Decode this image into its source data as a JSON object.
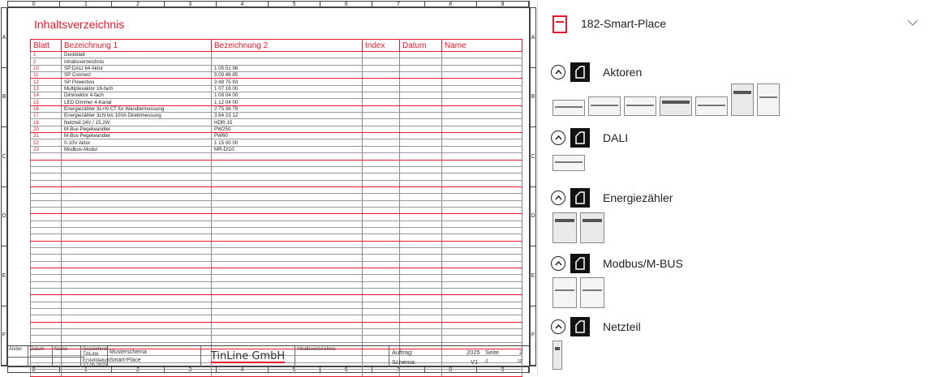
{
  "sheet": {
    "ruler_columns": [
      "0",
      "1",
      "2",
      "3",
      "4",
      "5",
      "6",
      "7",
      "8",
      "9"
    ],
    "ruler_rows": [
      "A",
      "B",
      "C",
      "D",
      "E",
      "F"
    ],
    "title": "Inhaltsverzeichnis",
    "columns": [
      "Blatt",
      "Bezeichnung 1",
      "Bezeichnung 2",
      "Index",
      "Datum",
      "Name"
    ],
    "rows": [
      [
        "1",
        "Deckblatt",
        ""
      ],
      [
        "2",
        "Inhaltsverzeichnis",
        ""
      ],
      [
        "10",
        "SP DALI 64 Aktor",
        "1 05 51 96"
      ],
      [
        "11",
        "SP Connect",
        "5 09 46 85"
      ],
      [
        "12",
        "SP Powerbox",
        "3 88 75 93"
      ],
      [
        "13",
        "Multiplexaktor 16-fach",
        "1 07 16 00"
      ],
      [
        "14",
        "Dimmaktor 4-fach",
        "1 08 04 00"
      ],
      [
        "15",
        "LED Dimmer 4-Kanal",
        "1 12 04 00"
      ],
      [
        "16",
        "Energiezähler 3L+N CT für Wandlermessung",
        "2 75 36 79"
      ],
      [
        "17",
        "Energiezähler 3LN bis 100A Direktmessung",
        "3 84 23 12"
      ],
      [
        "18",
        "Netzteil 24V / 15.2W",
        "HDR-15"
      ],
      [
        "20",
        "M-Bus Pegelwandler",
        "PW250"
      ],
      [
        "21",
        "M-Bus Pegelwandler",
        "PW60"
      ],
      [
        "22",
        "0-10V Aktor",
        "1 15 00 00"
      ],
      [
        "23",
        "Modbus-Modul",
        "MR-DI10"
      ]
    ],
    "title_block": {
      "aenderung": "Änder.",
      "datum": "Datum",
      "name": "Name",
      "gezeichnet": "Gezeichnet TinLine",
      "erstelldatum": "Erstelldatum 27.05.2025",
      "schema_name": "Musterschema",
      "project": "Smart-Place",
      "company": "TinLine  GmbH",
      "sheet_name": "Inhaltsverzeichnis",
      "auftrag_label": "Auftrag:",
      "auftrag_value": "2025",
      "schema_label": "Schema:",
      "schema_value": "V1",
      "seite_label": "Seite",
      "seite_value": "2",
      "von": "/1",
      "total": "10"
    }
  },
  "panel": {
    "project_name": "182-Smart-Place",
    "groups": [
      {
        "label": "Aktoren"
      },
      {
        "label": "DALI"
      },
      {
        "label": "Energiezähler"
      },
      {
        "label": "Modbus/M-BUS"
      },
      {
        "label": "Netzteil"
      }
    ],
    "colors": {
      "accent": "#e8192c",
      "icon_dark": "#111111"
    },
    "icons": [
      "document-icon",
      "chevron-down-icon",
      "collapse-up-icon",
      "folder-icon"
    ]
  }
}
